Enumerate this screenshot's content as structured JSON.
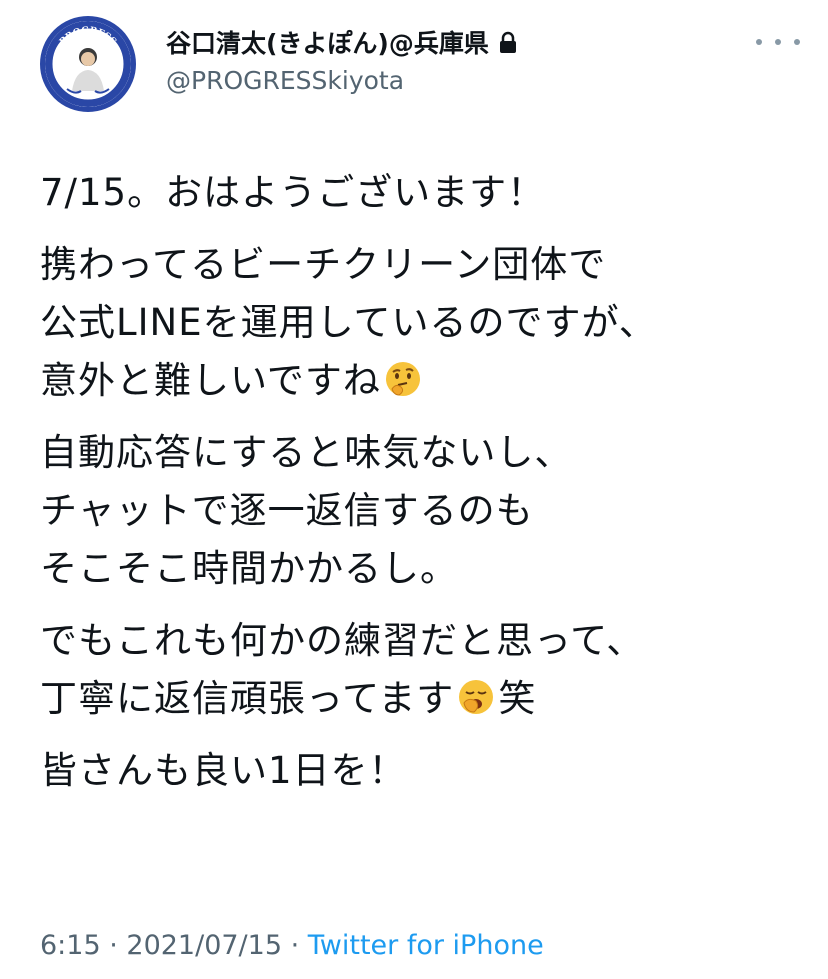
{
  "author": {
    "display_name": "谷口清太(きよぽん)@兵庫県",
    "handle": "@PROGRESSkiyota",
    "avatar_badge_text": "PROGRESS",
    "protected_icon": "lock-icon"
  },
  "tweet": {
    "paragraphs": [
      [
        "7/15。おはようございます！"
      ],
      [
        "携わってるビーチクリーン団体で",
        "公式LINEを運用しているのですが、",
        "意外と難しいですね"
      ],
      [
        "自動応答にすると味気ないし、",
        "チャットで逐一返信するのも",
        "そこそこ時間かかるし。"
      ],
      [
        "でもこれも何かの練習だと思って、",
        "丁寧に返信頑張ってます",
        "笑"
      ],
      [
        "皆さんも良い1日を！"
      ]
    ],
    "emojis": [
      "thinking-face-emoji",
      "yawning-face-emoji"
    ]
  },
  "meta": {
    "time": "6:15",
    "separator1": " · ",
    "date": "2021/07/15",
    "separator2": " · ",
    "source": "Twitter for iPhone"
  },
  "colors": {
    "text": "#0f1419",
    "secondary": "#536471",
    "link": "#1d9bf0",
    "avatar_ring": "#2a47a6"
  }
}
